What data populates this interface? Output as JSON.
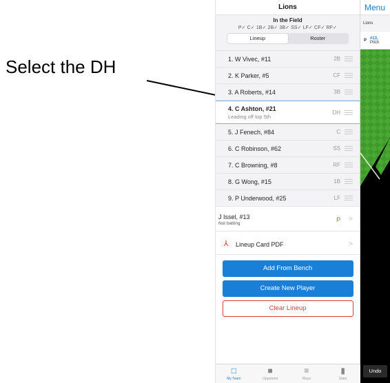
{
  "annotation": {
    "text": "Select the DH"
  },
  "panel": {
    "title": "Lions",
    "field_title": "In the Field",
    "field_positions": "P✓ C✓ 1B✓ 2B✓ 3B✓ SS✓ LF✓ CF✓ RF✓",
    "segments": [
      {
        "label": "Lineup",
        "active": true
      },
      {
        "label": "Roster",
        "active": false
      }
    ],
    "lineup": [
      {
        "name": "1. W Vivec, #11",
        "pos": "2B"
      },
      {
        "name": "2. K Parker, #5",
        "pos": "CF"
      },
      {
        "name": "3. A Roberts, #14",
        "pos": "3B"
      },
      {
        "name": "4. C Ashton, #21",
        "sub": "Leading off top 5th",
        "pos": "DH"
      },
      {
        "name": "5. J Fenech, #84",
        "pos": "C"
      },
      {
        "name": "6. C Robinson, #62",
        "pos": "SS"
      },
      {
        "name": "7. C Browning, #8",
        "pos": "RF"
      },
      {
        "name": "8. G Wong, #15",
        "pos": "1B"
      },
      {
        "name": "9. P Underwood, #25",
        "pos": "LF"
      }
    ],
    "pitcher": {
      "name": "J Issel, #13",
      "sub": "Not batting",
      "pos": "P",
      "chevron": ">"
    },
    "pdf": {
      "label": "Lineup Card PDF",
      "chevron": ">"
    },
    "buttons": {
      "add_bench": "Add From Bench",
      "create_player": "Create New Player",
      "clear_lineup": "Clear Lineup"
    },
    "tabs": [
      {
        "label": "My Team",
        "icon": "jersey-outline-icon",
        "active": true
      },
      {
        "label": "Opponent",
        "icon": "jersey-filled-icon",
        "active": false
      },
      {
        "label": "Plays",
        "icon": "list-icon",
        "active": false
      },
      {
        "label": "Stats",
        "icon": "bar-chart-icon",
        "active": false
      }
    ]
  },
  "right": {
    "menu": "Menu",
    "team": "Lions",
    "card": {
      "pos": "P",
      "line1": "#13,",
      "line2": "Pitch"
    },
    "undo": "Undo"
  },
  "colors": {
    "accent": "#1a7fd6",
    "danger": "#d43d3d",
    "selected_border": "#7ab0e4"
  }
}
